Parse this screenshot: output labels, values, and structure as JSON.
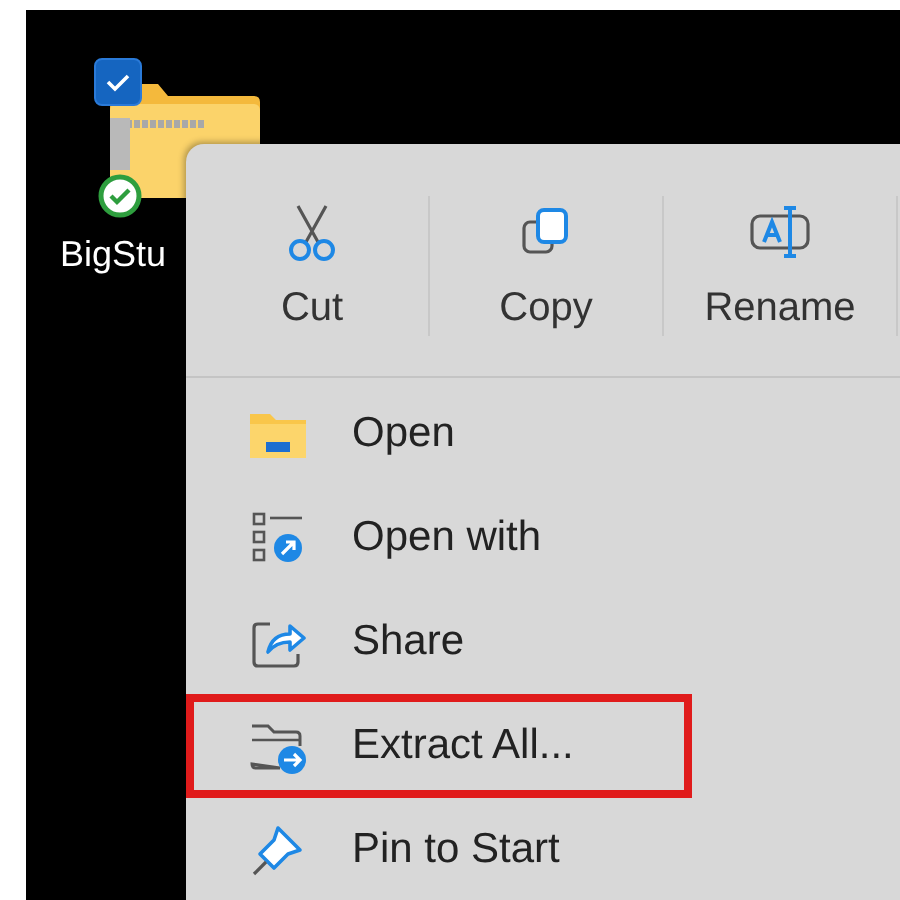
{
  "desktop_icon": {
    "label": "BigStu",
    "checked": true
  },
  "context_menu": {
    "toolbar": [
      {
        "label": "Cut"
      },
      {
        "label": "Copy"
      },
      {
        "label": "Rename"
      }
    ],
    "items": [
      {
        "label": "Open",
        "highlighted": false
      },
      {
        "label": "Open with",
        "highlighted": false
      },
      {
        "label": "Share",
        "highlighted": false
      },
      {
        "label": "Extract All...",
        "highlighted": true
      },
      {
        "label": "Pin to Start",
        "highlighted": false
      }
    ]
  }
}
